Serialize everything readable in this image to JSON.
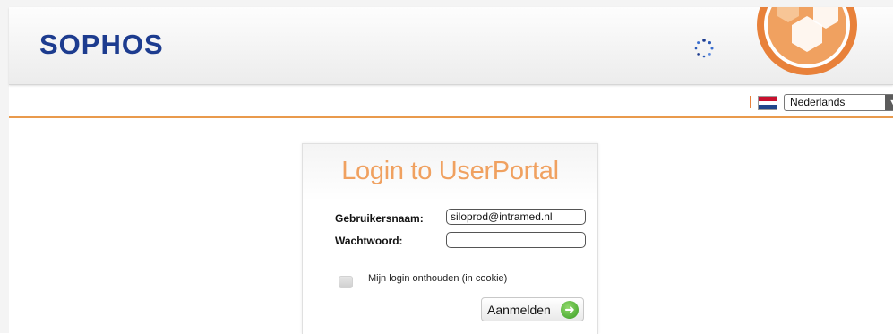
{
  "header": {
    "logo_text": "SOPHOS",
    "brand_color": "#1d3c8f",
    "accent_color": "#e8813a"
  },
  "language": {
    "selected": "Nederlands",
    "flag": "netherlands-flag-icon"
  },
  "login": {
    "title": "Login to UserPortal",
    "username_label": "Gebruikersnaam:",
    "username_value": "siloprod@intramed.nl",
    "password_label": "Wachtwoord:",
    "password_value": "",
    "remember_label": "Mijn login onthouden (in cookie)",
    "remember_checked": false,
    "submit_label": "Aanmelden",
    "title_color": "#f0a160",
    "submit_icon_color": "#3a9e25"
  }
}
